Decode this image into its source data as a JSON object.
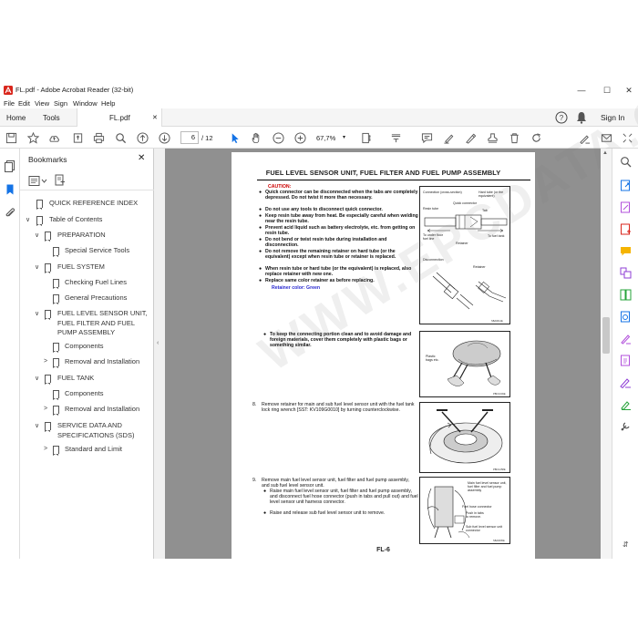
{
  "window": {
    "title": "FL.pdf - Adobe Acrobat Reader (32-bit)",
    "minimize": "—",
    "maximize": "☐",
    "close": "✕"
  },
  "menu": [
    "File",
    "Edit",
    "View",
    "Sign",
    "Window",
    "Help"
  ],
  "tabs": {
    "home": "Home",
    "tools": "Tools",
    "document": "FL.pdf",
    "close": "✕",
    "sign_in": "Sign In"
  },
  "toolbar": {
    "page_current": "6",
    "page_total": "/ 12",
    "zoom": "67,7%"
  },
  "bookmarks": {
    "title": "Bookmarks",
    "close": "✕",
    "items": [
      {
        "label": "QUICK REFERENCE INDEX",
        "chev": ""
      },
      {
        "label": "Table of Contents",
        "chev": "∨"
      },
      {
        "label": "PREPARATION",
        "chev": "∨"
      },
      {
        "label": "Special Service Tools",
        "chev": ""
      },
      {
        "label": "FUEL SYSTEM",
        "chev": "∨"
      },
      {
        "label": "Checking Fuel Lines",
        "chev": ""
      },
      {
        "label": "General Precautions",
        "chev": ""
      },
      {
        "label": "FUEL LEVEL SENSOR UNIT, FUEL FILTER AND FUEL PUMP ASSEMBLY",
        "chev": "∨"
      },
      {
        "label": "Components",
        "chev": ""
      },
      {
        "label": "Removal and Installation",
        "chev": ">"
      },
      {
        "label": "FUEL TANK",
        "chev": "∨"
      },
      {
        "label": "Components",
        "chev": ""
      },
      {
        "label": "Removal and Installation",
        "chev": ">"
      },
      {
        "label": "SERVICE DATA AND SPECIFICATIONS (SDS)",
        "chev": "∨"
      },
      {
        "label": "Standard and Limit",
        "chev": ">"
      }
    ]
  },
  "document": {
    "title": "FUEL LEVEL SENSOR UNIT, FUEL FILTER AND FUEL PUMP ASSEMBLY",
    "caution_heading": "CAUTION:",
    "caution_items": [
      "Quick connector can be disconnected when the tabs are completely depressed. Do not twist it more than necessary.",
      "Do not use any tools to disconnect quick connector.",
      "Keep resin tube away from heat. Be especially careful when welding near the resin tube.",
      "Prevent acid liquid such as battery electrolyte, etc. from getting on resin tube.",
      "Do not bend or twist resin tube during installation and disconnection.",
      "Do not remove the remaining retainer on hard tube (or the equivalent) except when resin tube or retainer is replaced.",
      "When resin tube or hard tube (or the equivalent) is replaced, also replace retainer with new one.",
      "Replace same color retainer as before replacing."
    ],
    "retainer_color": "Retainer color: Green",
    "bullet_plastic": "To keep the connecting portion clean and to avoid damage and foreign materials, cover them completely with plastic bags or something similar.",
    "step8_num": "8.",
    "step8": "Remove retainer for main and sub fuel level sensor unit with the fuel tank lock ring wrench [SST: KV109G0010] by turning counterclockwise.",
    "step9_num": "9.",
    "step9": "Remove main fuel level sensor unit, fuel filter and fuel pump assembly, and sub fuel level sensor unit.",
    "step9_bullets": [
      "Raise main fuel level sensor unit, fuel filter and fuel pump assembly, and disconnect fuel hose connector (push in tabs and pull out) and fuel level sensor unit harness connector.",
      "Raise and release sub fuel level sensor unit to remove."
    ],
    "fig1": {
      "labels": [
        "Connection (cross-section)",
        "Hard tube (or the equivalent)",
        "Quick connector",
        "Resin tube",
        "Tab",
        "To under floor fuel line",
        "To fuel tank",
        "Retainer",
        "Disconnection",
        "Retainer"
      ],
      "code": "SBA0014E"
    },
    "fig2": {
      "labels": [
        "Plastic bags etc."
      ],
      "code": "PBIC1049E"
    },
    "fig3": {
      "code": "PBIC1258E"
    },
    "fig4": {
      "labels": [
        "Main fuel level sensor unit, fuel filter and fuel pump assembly",
        "Fuel hose connector",
        "Push in tabs to remove.",
        "Sub fuel level sensor unit connector"
      ],
      "code": "SBA0095E"
    },
    "footer": "FL-6",
    "watermark": "WWW.EPCDATA.COM"
  },
  "colors": {
    "accent": "#1473e6",
    "caution": "#cc0000",
    "retainer_text": "#2b2bd0",
    "doc_background": "#909090"
  }
}
